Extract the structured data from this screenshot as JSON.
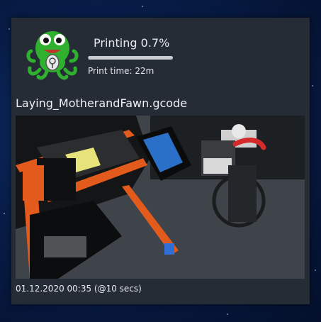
{
  "status": {
    "title": "Printing 0.7%",
    "progress_fraction": 0.007,
    "print_time": "Print time: 22m"
  },
  "job": {
    "filename": "Laying_MotherandFawn.gcode"
  },
  "webcam": {
    "timestamp": "01.12.2020 00:35 (@10 secs)"
  },
  "logo": {
    "name": "octoprint-octopus-logo"
  }
}
